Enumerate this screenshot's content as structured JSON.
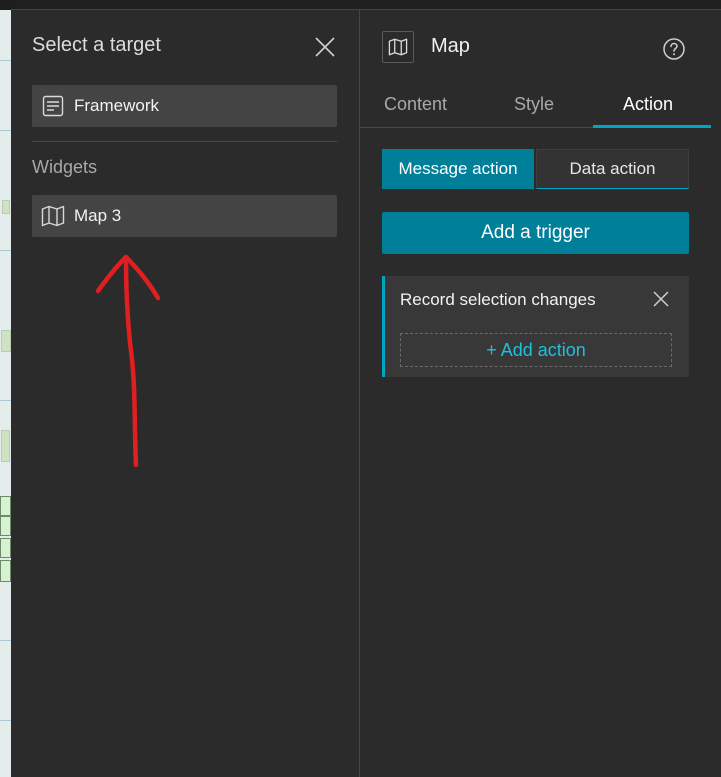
{
  "colors": {
    "accent": "#007f99",
    "accent_line": "#00a5c4",
    "link": "#1ec0e0",
    "annotation": "#e02020"
  },
  "left_panel": {
    "title": "Select a target",
    "close_icon": "close-icon",
    "framework": {
      "label": "Framework",
      "icon": "document-icon"
    },
    "section_label": "Widgets",
    "widgets": [
      {
        "label": "Map 3",
        "icon": "map-icon"
      }
    ]
  },
  "right_panel": {
    "title": "Map",
    "title_icon": "map-icon",
    "help_icon": "help-icon",
    "tabs": [
      {
        "label": "Content",
        "active": false
      },
      {
        "label": "Style",
        "active": false
      },
      {
        "label": "Action",
        "active": true
      }
    ],
    "segments": {
      "message": "Message action",
      "data": "Data action"
    },
    "add_trigger": "Add a trigger",
    "trigger_card": {
      "title": "Record selection changes",
      "add_action": "+ Add action"
    }
  },
  "annotation": {
    "type": "red-arrow-icon"
  }
}
